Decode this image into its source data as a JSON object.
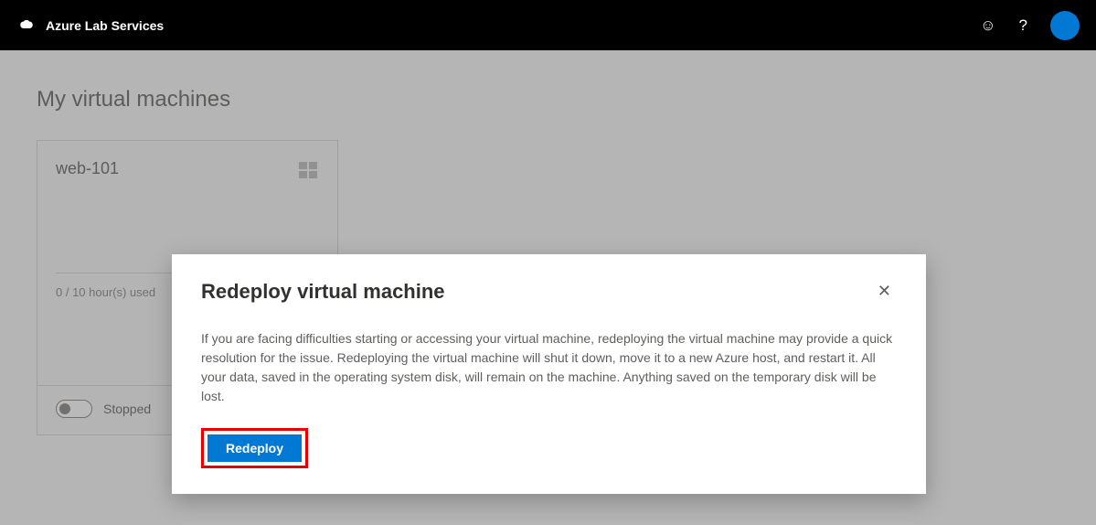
{
  "header": {
    "brand": "Azure Lab Services"
  },
  "page": {
    "title": "My virtual machines"
  },
  "vm": {
    "name": "web-101",
    "hours": "0 / 10 hour(s) used",
    "status": "Stopped"
  },
  "dialog": {
    "title": "Redeploy virtual machine",
    "body": "If you are facing difficulties starting or accessing your virtual machine, redeploying the virtual machine may provide a quick resolution for the issue. Redeploying the virtual machine will shut it down, move it to a new Azure host, and restart it. All your data, saved in the operating system disk, will remain on the machine. Anything saved on the temporary disk will be lost.",
    "redeploy_label": "Redeploy"
  }
}
